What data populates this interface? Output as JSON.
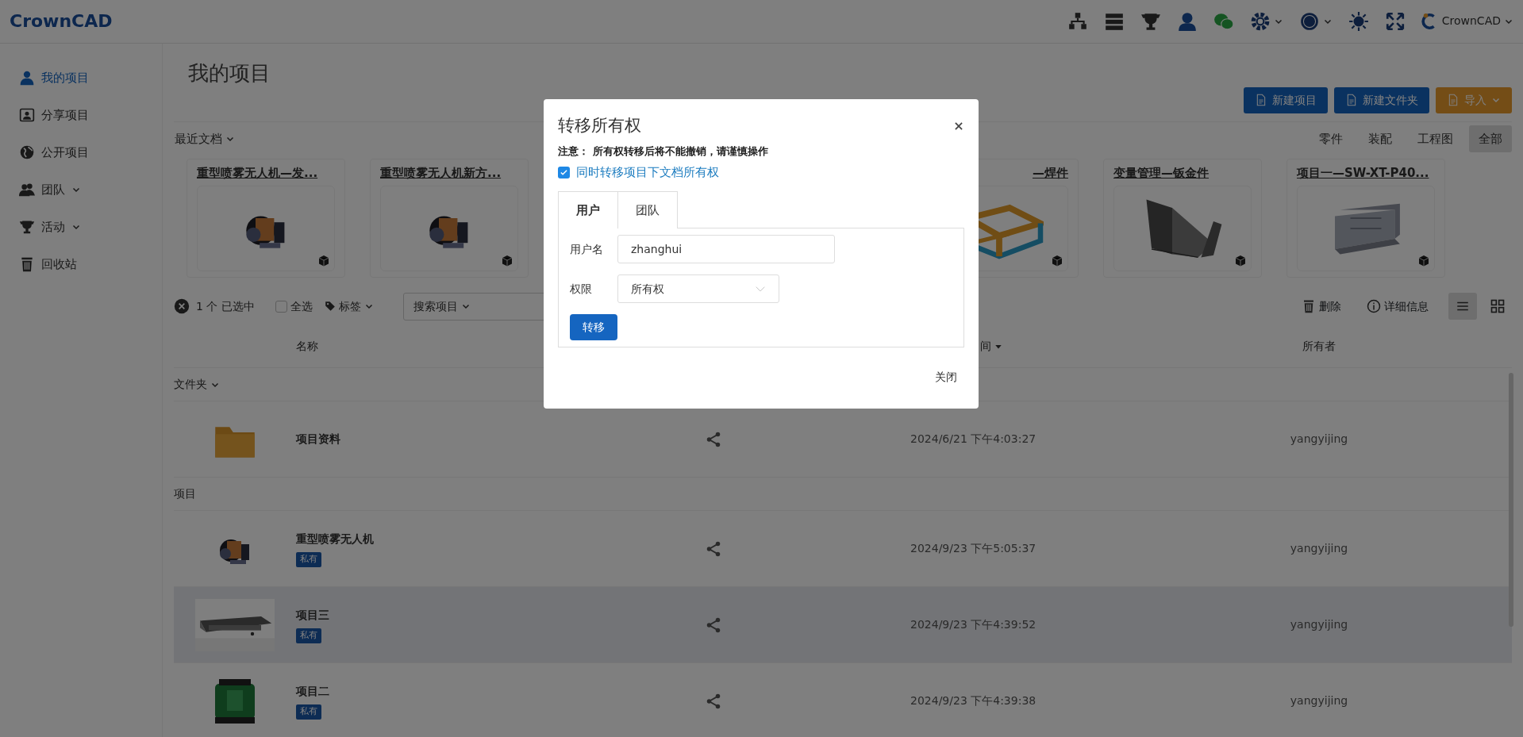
{
  "header": {
    "logo": "CrownCAD",
    "user": "CrownCAD"
  },
  "sidebar": {
    "items": [
      {
        "label": "我的项目",
        "selected": true,
        "dropdown": false
      },
      {
        "label": "分享项目",
        "selected": false,
        "dropdown": false
      },
      {
        "label": "公开项目",
        "selected": false,
        "dropdown": false
      },
      {
        "label": "团队",
        "selected": false,
        "dropdown": true
      },
      {
        "label": "活动",
        "selected": false,
        "dropdown": true
      },
      {
        "label": "回收站",
        "selected": false,
        "dropdown": false
      }
    ]
  },
  "page_title": "我的项目",
  "actions": [
    {
      "label": "新建项目",
      "kind": "primary",
      "dropdown": false
    },
    {
      "label": "新建文件夹",
      "kind": "primary",
      "dropdown": false
    },
    {
      "label": "导入",
      "kind": "warning",
      "dropdown": true
    }
  ],
  "recent": {
    "label": "最近文档",
    "filters": [
      {
        "label": "零件",
        "selected": false
      },
      {
        "label": "装配",
        "selected": false
      },
      {
        "label": "工程图",
        "selected": false
      },
      {
        "label": "全部",
        "selected": true
      }
    ],
    "docs": [
      {
        "kind": "doc",
        "title": "重型喷雾无人机—发..."
      },
      {
        "kind": "doc",
        "title": "重型喷雾无人机新方..."
      },
      {
        "kind": "covered"
      },
      {
        "kind": "covered"
      },
      {
        "kind": "doc",
        "title": "—焊件"
      },
      {
        "kind": "doc",
        "title": "变量管理—钣金件"
      },
      {
        "kind": "doc",
        "title": "项目一—SW-XT-P40..."
      }
    ]
  },
  "toolbar": {
    "selected_count": "1 个 已选中",
    "select_all": {
      "label": "全选",
      "checked": false
    },
    "tags": "标签",
    "search": "搜索项目",
    "delete": "删除",
    "details": "详细信息",
    "views": [
      {
        "kind": "list",
        "selected": true
      },
      {
        "kind": "grid",
        "selected": false
      }
    ]
  },
  "table": {
    "columns": [
      {
        "label": "名称",
        "sorted": false
      },
      {
        "label": "间",
        "sorted": true
      },
      {
        "label": "所有者",
        "sorted": false
      }
    ],
    "sections": [
      {
        "label": "文件夹",
        "dropdown": true,
        "rows": [
          {
            "kind": "folder",
            "name": "项目资料",
            "modified": "2024/6/21 下午4:03:27",
            "owner": "yangyijing",
            "selected": false
          }
        ]
      },
      {
        "label": "项目",
        "dropdown": false,
        "rows": [
          {
            "kind": "project",
            "name": "重型喷雾无人机",
            "badge": "私有",
            "modified": "2024/9/23 下午5:05:37",
            "owner": "yangyijing",
            "selected": false
          },
          {
            "kind": "project",
            "name": "项目三",
            "badge": "私有",
            "modified": "2024/9/23 下午4:39:52",
            "owner": "yangyijing",
            "selected": true
          },
          {
            "kind": "project",
            "name": "项目二",
            "badge": "私有",
            "modified": "2024/9/23 下午4:39:38",
            "owner": "yangyijing",
            "selected": false
          }
        ]
      }
    ]
  },
  "modal": {
    "title": "转移所有权",
    "note": "注意： 所有权转移后将不能撤销，请谨慎操作",
    "also_docs": {
      "label": "同时转移项目下文档所有权",
      "checked": true
    },
    "tabs": [
      {
        "label": "用户",
        "selected": true
      },
      {
        "label": "团队",
        "selected": false
      }
    ],
    "username": {
      "label": "用户名",
      "value": "zhanghui"
    },
    "permission": {
      "label": "权限",
      "value": "所有权"
    },
    "submit": "转移",
    "close": "关闭"
  }
}
